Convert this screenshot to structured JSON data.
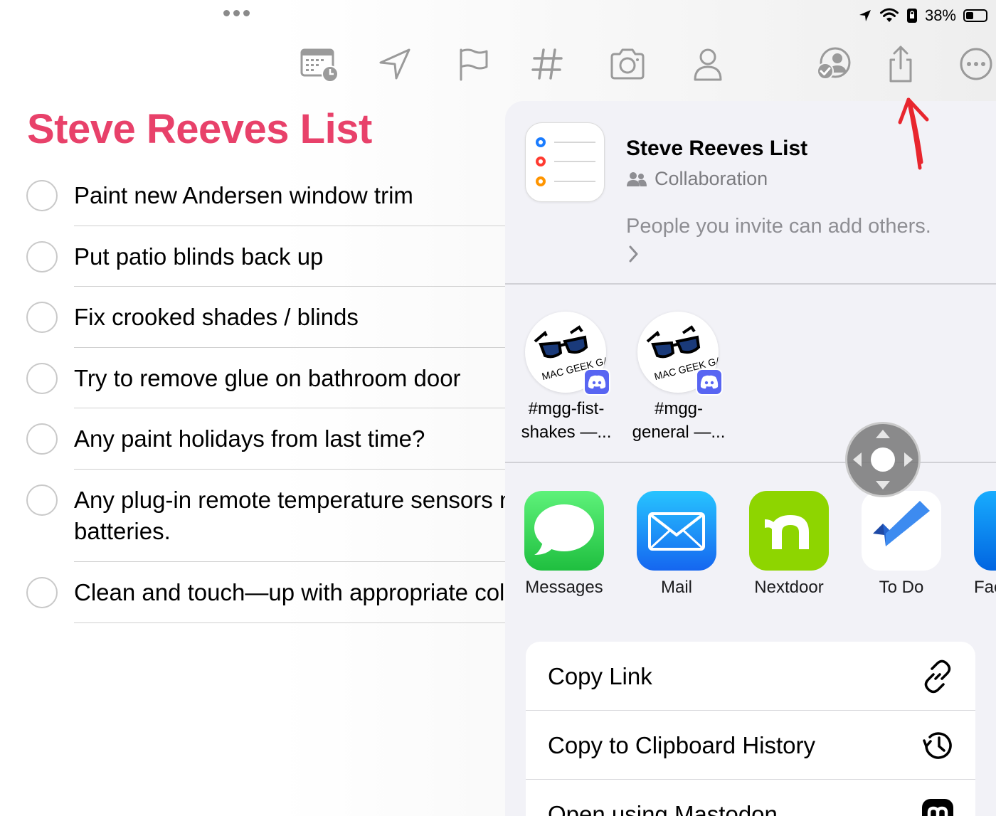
{
  "status_bar": {
    "battery_percent": "38%"
  },
  "toolbar": {
    "icons": [
      "calendar-clock-icon",
      "location-arrow-icon",
      "flag-icon",
      "hashtag-icon",
      "camera-icon",
      "person-icon",
      "collaboration-icon",
      "share-icon",
      "more-icon"
    ]
  },
  "list": {
    "title": "Steve Reeves List",
    "accent_color": "#e8416a",
    "items": [
      {
        "text": "Paint new Andersen window trim"
      },
      {
        "text": "Put patio blinds back up"
      },
      {
        "text": "Fix crooked shades / blinds"
      },
      {
        "text": "Try to remove glue on bathroom door"
      },
      {
        "text": "Any paint holidays from last time?"
      },
      {
        "text": "Any plug-in remote temperature sensors need",
        "text2": "batteries."
      },
      {
        "text": "Clean and touch—up with appropriate color"
      }
    ]
  },
  "share_sheet": {
    "title": "Steve Reeves List",
    "mode": "Collaboration",
    "note": "People you invite can add others.",
    "people": [
      {
        "line1": "#mgg-fist-",
        "line2": "shakes —...",
        "avatar_text": "MAC GEEK GAB"
      },
      {
        "line1": "#mgg-",
        "line2": "general —...",
        "avatar_text": "MAC GEEK GAB"
      }
    ],
    "apps": [
      {
        "label": "Messages",
        "color": "#34c759"
      },
      {
        "label": "Mail",
        "color": "#1e90ff"
      },
      {
        "label": "Nextdoor",
        "color": "#8ed500"
      },
      {
        "label": "To Do",
        "color": "#2564cf"
      },
      {
        "label": "Fac",
        "color": "#1877f2"
      }
    ],
    "actions": [
      {
        "label": "Copy Link",
        "icon": "link-icon"
      },
      {
        "label": "Copy to Clipboard History",
        "icon": "history-icon"
      },
      {
        "label": "Open using Mastodon",
        "icon": "mastodon-icon"
      }
    ]
  }
}
